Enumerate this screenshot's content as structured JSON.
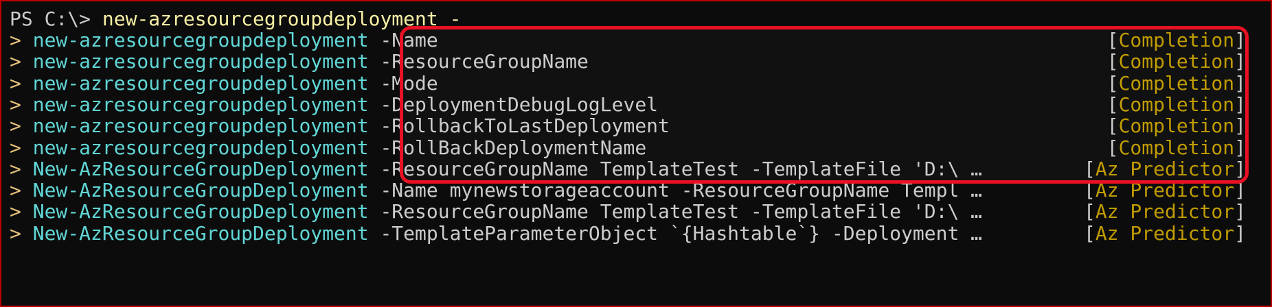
{
  "prompt": {
    "ps": "PS C:\\>",
    "typed": "new-azresourcegroupdeployment -"
  },
  "caret": ">",
  "completions": [
    {
      "cmd": "new-azresourcegroupdeployment",
      "param": "-Name",
      "source": "Completion"
    },
    {
      "cmd": "new-azresourcegroupdeployment",
      "param": "-ResourceGroupName",
      "source": "Completion"
    },
    {
      "cmd": "new-azresourcegroupdeployment",
      "param": "-Mode",
      "source": "Completion"
    },
    {
      "cmd": "new-azresourcegroupdeployment",
      "param": "-DeploymentDebugLogLevel",
      "source": "Completion"
    },
    {
      "cmd": "new-azresourcegroupdeployment",
      "param": "-RollbackToLastDeployment",
      "source": "Completion"
    },
    {
      "cmd": "new-azresourcegroupdeployment",
      "param": "-RollBackDeploymentName",
      "source": "Completion"
    }
  ],
  "predictions": [
    {
      "cmd": "New-AzResourceGroupDeployment",
      "param": "-ResourceGroupName TemplateTest -TemplateFile 'D:\\ …",
      "source": "Az Predictor"
    },
    {
      "cmd": "New-AzResourceGroupDeployment",
      "param": "-Name mynewstorageaccount -ResourceGroupName Templ …",
      "source": "Az Predictor"
    },
    {
      "cmd": "New-AzResourceGroupDeployment",
      "param": "-ResourceGroupName TemplateTest -TemplateFile 'D:\\ …",
      "source": "Az Predictor"
    },
    {
      "cmd": "New-AzResourceGroupDeployment",
      "param": "-TemplateParameterObject `{Hashtable`} -Deployment …",
      "source": "Az Predictor"
    }
  ],
  "colors": {
    "background": "#0c0c0c",
    "command": "#61d6d6",
    "source": "#c19c00",
    "highlight": "#e81123"
  }
}
